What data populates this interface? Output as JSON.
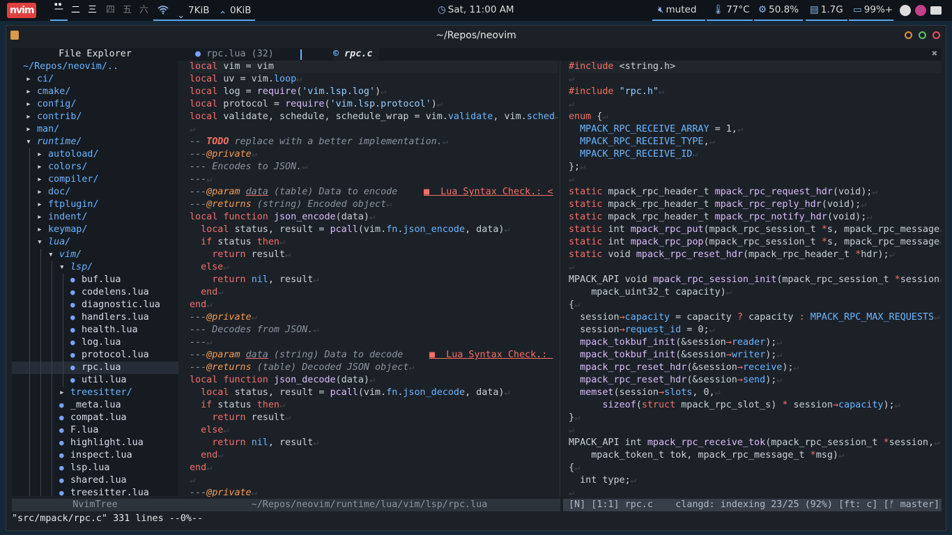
{
  "topbar": {
    "logo": "nvim",
    "workspaces": [
      "一",
      "二",
      "三",
      "四",
      "五",
      "六"
    ],
    "net_down": "7KiB",
    "net_up": "0KiB",
    "clock": "Sat, 11:00 AM",
    "volume": "muted",
    "temp": "77°C",
    "cpu": "50.8%",
    "mem": "1.7G",
    "battery": "99%+",
    "colors": {
      "accent": "#5fa8e8",
      "logo": "#e04040"
    }
  },
  "window": {
    "title": "~/Repos/neovim"
  },
  "tree": {
    "header": "File Explorer",
    "root": "~/Repos/neovim/..",
    "rows": [
      {
        "name": "ci/",
        "kind": "folder",
        "depth": 0,
        "open": false
      },
      {
        "name": "cmake/",
        "kind": "folder",
        "depth": 0,
        "open": false
      },
      {
        "name": "config/",
        "kind": "folder",
        "depth": 0,
        "open": false
      },
      {
        "name": "contrib/",
        "kind": "folder",
        "depth": 0,
        "open": false
      },
      {
        "name": "man/",
        "kind": "folder",
        "depth": 0,
        "open": false
      },
      {
        "name": "runtime/",
        "kind": "folder",
        "depth": 0,
        "open": true
      },
      {
        "name": "autoload/",
        "kind": "folder",
        "depth": 1,
        "open": false
      },
      {
        "name": "colors/",
        "kind": "folder",
        "depth": 1,
        "open": false
      },
      {
        "name": "compiler/",
        "kind": "folder",
        "depth": 1,
        "open": false
      },
      {
        "name": "doc/",
        "kind": "folder",
        "depth": 1,
        "open": false
      },
      {
        "name": "ftplugin/",
        "kind": "folder",
        "depth": 1,
        "open": false
      },
      {
        "name": "indent/",
        "kind": "folder",
        "depth": 1,
        "open": false
      },
      {
        "name": "keymap/",
        "kind": "folder",
        "depth": 1,
        "open": false
      },
      {
        "name": "lua/",
        "kind": "folder",
        "depth": 1,
        "open": true
      },
      {
        "name": "vim/",
        "kind": "folder",
        "depth": 2,
        "open": true
      },
      {
        "name": "lsp/",
        "kind": "folder",
        "depth": 3,
        "open": true
      },
      {
        "name": "buf.lua",
        "kind": "file",
        "depth": 4
      },
      {
        "name": "codelens.lua",
        "kind": "file",
        "depth": 4
      },
      {
        "name": "diagnostic.lua",
        "kind": "file",
        "depth": 4
      },
      {
        "name": "handlers.lua",
        "kind": "file",
        "depth": 4
      },
      {
        "name": "health.lua",
        "kind": "file",
        "depth": 4
      },
      {
        "name": "log.lua",
        "kind": "file",
        "depth": 4
      },
      {
        "name": "protocol.lua",
        "kind": "file",
        "depth": 4
      },
      {
        "name": "rpc.lua",
        "kind": "file",
        "depth": 4,
        "selected": true
      },
      {
        "name": "util.lua",
        "kind": "file",
        "depth": 4
      },
      {
        "name": "treesitter/",
        "kind": "folder",
        "depth": 3,
        "open": false
      },
      {
        "name": "_meta.lua",
        "kind": "file",
        "depth": 3
      },
      {
        "name": "compat.lua",
        "kind": "file",
        "depth": 3
      },
      {
        "name": "F.lua",
        "kind": "file",
        "depth": 3
      },
      {
        "name": "highlight.lua",
        "kind": "file",
        "depth": 3
      },
      {
        "name": "inspect.lua",
        "kind": "file",
        "depth": 3
      },
      {
        "name": "lsp.lua",
        "kind": "file",
        "depth": 3
      },
      {
        "name": "shared.lua",
        "kind": "file",
        "depth": 3
      },
      {
        "name": "treesitter.lua",
        "kind": "file",
        "depth": 3
      }
    ]
  },
  "tabs": {
    "inactive_name": "rpc.lua",
    "inactive_count": "(32)",
    "active_name": "rpc.c",
    "close": "✖"
  },
  "lua_lines": [
    [
      [
        "kw",
        "local"
      ],
      [
        "t",
        " vim = vim"
      ]
    ],
    [
      [
        "kw",
        "local"
      ],
      [
        "t",
        " uv = vim."
      ],
      [
        "prop",
        "loop"
      ]
    ],
    [
      [
        "kw",
        "local"
      ],
      [
        "t",
        " log = "
      ],
      [
        "fn",
        "require"
      ],
      [
        "t",
        "("
      ],
      [
        "str",
        "'vim.lsp.log'"
      ],
      [
        "t",
        ")"
      ]
    ],
    [
      [
        "kw",
        "local"
      ],
      [
        "t",
        " protocol = "
      ],
      [
        "fn",
        "require"
      ],
      [
        "t",
        "("
      ],
      [
        "str",
        "'vim.lsp.protocol'"
      ],
      [
        "t",
        ")"
      ]
    ],
    [
      [
        "kw",
        "local"
      ],
      [
        "t",
        " validate, schedule, schedule_wrap = vim."
      ],
      [
        "prop",
        "validate"
      ],
      [
        "t",
        ", vim."
      ],
      [
        "prop",
        "sched"
      ]
    ],
    [],
    [
      [
        "cm",
        "-- "
      ],
      [
        "todo",
        "TODO"
      ],
      [
        "cm",
        " replace with a better implementation."
      ]
    ],
    [
      [
        "cm",
        "---"
      ],
      [
        "ann",
        "@private"
      ]
    ],
    [
      [
        "cm",
        "--- Encodes to JSON."
      ]
    ],
    [
      [
        "cm",
        "---"
      ]
    ],
    [
      [
        "cm",
        "---"
      ],
      [
        "ann",
        "@param"
      ],
      [
        "cm",
        " "
      ],
      [
        "cmu",
        "data"
      ],
      [
        "cm",
        " (table) Data to encode"
      ],
      [
        "diag",
        "■  Lua Syntax Check.: <"
      ]
    ],
    [
      [
        "cm",
        "---"
      ],
      [
        "ann",
        "@returns"
      ],
      [
        "cm",
        " (string) Encoded object"
      ]
    ],
    [
      [
        "kw",
        "local function"
      ],
      [
        "t",
        " "
      ],
      [
        "fn",
        "json_encode"
      ],
      [
        "t",
        "(data)"
      ]
    ],
    [
      [
        "t",
        "  "
      ],
      [
        "kw",
        "local"
      ],
      [
        "t",
        " status, result = "
      ],
      [
        "fn",
        "pcall"
      ],
      [
        "t",
        "(vim."
      ],
      [
        "prop",
        "fn"
      ],
      [
        "t",
        "."
      ],
      [
        "prop",
        "json_encode"
      ],
      [
        "t",
        ", data)"
      ]
    ],
    [
      [
        "t",
        "  "
      ],
      [
        "kw",
        "if"
      ],
      [
        "t",
        " status "
      ],
      [
        "kw",
        "then"
      ]
    ],
    [
      [
        "t",
        "    "
      ],
      [
        "kw",
        "return"
      ],
      [
        "t",
        " result"
      ]
    ],
    [
      [
        "t",
        "  "
      ],
      [
        "kw",
        "else"
      ]
    ],
    [
      [
        "t",
        "    "
      ],
      [
        "kw",
        "return"
      ],
      [
        "t",
        " "
      ],
      [
        "prop",
        "nil"
      ],
      [
        "t",
        ", result"
      ]
    ],
    [
      [
        "t",
        "  "
      ],
      [
        "kw",
        "end"
      ]
    ],
    [
      [
        "kw",
        "end"
      ]
    ],
    [
      [
        "cm",
        "---"
      ],
      [
        "ann",
        "@private"
      ]
    ],
    [
      [
        "cm",
        "--- Decodes from JSON."
      ]
    ],
    [
      [
        "cm",
        "---"
      ]
    ],
    [
      [
        "cm",
        "---"
      ],
      [
        "ann",
        "@param"
      ],
      [
        "cm",
        " "
      ],
      [
        "cmu",
        "data"
      ],
      [
        "cm",
        " (string) Data to decode"
      ],
      [
        "diag",
        "■  Lua Syntax Check.: "
      ]
    ],
    [
      [
        "cm",
        "---"
      ],
      [
        "ann",
        "@returns"
      ],
      [
        "cm",
        " (table) Decoded JSON object"
      ]
    ],
    [
      [
        "kw",
        "local function"
      ],
      [
        "t",
        " "
      ],
      [
        "fn",
        "json_decode"
      ],
      [
        "t",
        "(data)"
      ]
    ],
    [
      [
        "t",
        "  "
      ],
      [
        "kw",
        "local"
      ],
      [
        "t",
        " status, result = "
      ],
      [
        "fn",
        "pcall"
      ],
      [
        "t",
        "(vim."
      ],
      [
        "prop",
        "fn"
      ],
      [
        "t",
        "."
      ],
      [
        "prop",
        "json_decode"
      ],
      [
        "t",
        ", data)"
      ]
    ],
    [
      [
        "t",
        "  "
      ],
      [
        "kw",
        "if"
      ],
      [
        "t",
        " status "
      ],
      [
        "kw",
        "then"
      ]
    ],
    [
      [
        "t",
        "    "
      ],
      [
        "kw",
        "return"
      ],
      [
        "t",
        " result"
      ]
    ],
    [
      [
        "t",
        "  "
      ],
      [
        "kw",
        "else"
      ]
    ],
    [
      [
        "t",
        "    "
      ],
      [
        "kw",
        "return"
      ],
      [
        "t",
        " "
      ],
      [
        "prop",
        "nil"
      ],
      [
        "t",
        ", result"
      ]
    ],
    [
      [
        "t",
        "  "
      ],
      [
        "kw",
        "end"
      ]
    ],
    [
      [
        "kw",
        "end"
      ]
    ],
    [],
    [
      [
        "cm",
        "---"
      ],
      [
        "ann",
        "@private"
      ]
    ]
  ],
  "lua_error_lines": [
    10,
    23
  ],
  "c_lines": [
    [
      [
        "pp",
        "#include"
      ],
      [
        "t",
        " <string.h>"
      ]
    ],
    [],
    [
      [
        "pp",
        "#include"
      ],
      [
        "t",
        " "
      ],
      [
        "str",
        "\"rpc.h\""
      ]
    ],
    [],
    [
      [
        "kw",
        "enum"
      ],
      [
        "t",
        " {"
      ]
    ],
    [
      [
        "t",
        "  "
      ],
      [
        "const",
        "MPACK_RPC_RECEIVE_ARRAY"
      ],
      [
        "t",
        " = 1,"
      ]
    ],
    [
      [
        "t",
        "  "
      ],
      [
        "const",
        "MPACK_RPC_RECEIVE_TYPE"
      ],
      [
        "t",
        ","
      ]
    ],
    [
      [
        "t",
        "  "
      ],
      [
        "const",
        "MPACK_RPC_RECEIVE_ID"
      ]
    ],
    [
      [
        "t",
        "};"
      ]
    ],
    [],
    [
      [
        "kw",
        "static"
      ],
      [
        "t",
        " mpack_rpc_header_t "
      ],
      [
        "fn",
        "mpack_rpc_request_hdr"
      ],
      [
        "t",
        "(void);"
      ]
    ],
    [
      [
        "kw",
        "static"
      ],
      [
        "t",
        " mpack_rpc_header_t "
      ],
      [
        "fn",
        "mpack_rpc_reply_hdr"
      ],
      [
        "t",
        "(void);"
      ]
    ],
    [
      [
        "kw",
        "static"
      ],
      [
        "t",
        " mpack_rpc_header_t "
      ],
      [
        "fn",
        "mpack_rpc_notify_hdr"
      ],
      [
        "t",
        "(void);"
      ]
    ],
    [
      [
        "kw",
        "static"
      ],
      [
        "t",
        " int "
      ],
      [
        "fn",
        "mpack_rpc_put"
      ],
      [
        "t",
        "(mpack_rpc_session_t "
      ],
      [
        "ptr",
        "*"
      ],
      [
        "t",
        "s, mpack_rpc_message"
      ]
    ],
    [
      [
        "kw",
        "static"
      ],
      [
        "t",
        " int "
      ],
      [
        "fn",
        "mpack_rpc_pop"
      ],
      [
        "t",
        "(mpack_rpc_session_t "
      ],
      [
        "ptr",
        "*"
      ],
      [
        "t",
        "s, mpack_rpc_message"
      ]
    ],
    [
      [
        "kw",
        "static"
      ],
      [
        "t",
        " void "
      ],
      [
        "fn",
        "mpack_rpc_reset_hdr"
      ],
      [
        "t",
        "(mpack_rpc_header_t "
      ],
      [
        "ptr",
        "*"
      ],
      [
        "t",
        "hdr);"
      ]
    ],
    [],
    [
      [
        "t",
        "MPACK_API void "
      ],
      [
        "fn",
        "mpack_rpc_session_init"
      ],
      [
        "t",
        "(mpack_rpc_session_t "
      ],
      [
        "ptr",
        "*"
      ],
      [
        "t",
        "session"
      ]
    ],
    [
      [
        "t",
        "    mpack_uint32_t capacity)"
      ]
    ],
    [
      [
        "t",
        "{"
      ]
    ],
    [
      [
        "t",
        "  session"
      ],
      [
        "kw",
        "→"
      ],
      [
        "prop",
        "capacity"
      ],
      [
        "t",
        " = capacity "
      ],
      [
        "kw",
        "?"
      ],
      [
        "t",
        " capacity "
      ],
      [
        "kw",
        ":"
      ],
      [
        "t",
        " "
      ],
      [
        "const",
        "MPACK_RPC_MAX_REQUESTS"
      ]
    ],
    [
      [
        "t",
        "  session"
      ],
      [
        "kw",
        "→"
      ],
      [
        "prop",
        "request_id"
      ],
      [
        "t",
        " = 0;"
      ]
    ],
    [
      [
        "t",
        "  "
      ],
      [
        "fn",
        "mpack_tokbuf_init"
      ],
      [
        "t",
        "(&session"
      ],
      [
        "kw",
        "→"
      ],
      [
        "prop",
        "reader"
      ],
      [
        "t",
        ");"
      ]
    ],
    [
      [
        "t",
        "  "
      ],
      [
        "fn",
        "mpack_tokbuf_init"
      ],
      [
        "t",
        "(&session"
      ],
      [
        "kw",
        "→"
      ],
      [
        "prop",
        "writer"
      ],
      [
        "t",
        ");"
      ]
    ],
    [
      [
        "t",
        "  "
      ],
      [
        "fn",
        "mpack_rpc_reset_hdr"
      ],
      [
        "t",
        "(&session"
      ],
      [
        "kw",
        "→"
      ],
      [
        "prop",
        "receive"
      ],
      [
        "t",
        ");"
      ]
    ],
    [
      [
        "t",
        "  "
      ],
      [
        "fn",
        "mpack_rpc_reset_hdr"
      ],
      [
        "t",
        "(&session"
      ],
      [
        "kw",
        "→"
      ],
      [
        "prop",
        "send"
      ],
      [
        "t",
        ");"
      ]
    ],
    [
      [
        "t",
        "  "
      ],
      [
        "fn",
        "memset"
      ],
      [
        "t",
        "(session"
      ],
      [
        "kw",
        "→"
      ],
      [
        "prop",
        "slots"
      ],
      [
        "t",
        ", 0,"
      ]
    ],
    [
      [
        "t",
        "      "
      ],
      [
        "fn",
        "sizeof"
      ],
      [
        "t",
        "("
      ],
      [
        "kw",
        "struct"
      ],
      [
        "t",
        " mpack_rpc_slot_s) "
      ],
      [
        "kw",
        "*"
      ],
      [
        "t",
        " session"
      ],
      [
        "kw",
        "→"
      ],
      [
        "prop",
        "capacity"
      ],
      [
        "t",
        ");"
      ]
    ],
    [
      [
        "t",
        "}"
      ]
    ],
    [],
    [
      [
        "t",
        "MPACK_API int "
      ],
      [
        "fn",
        "mpack_rpc_receive_tok"
      ],
      [
        "t",
        "(mpack_rpc_session_t "
      ],
      [
        "ptr",
        "*"
      ],
      [
        "t",
        "session,"
      ]
    ],
    [
      [
        "t",
        "    mpack_token_t tok, mpack_rpc_message_t "
      ],
      [
        "ptr",
        "*"
      ],
      [
        "t",
        "msg)"
      ]
    ],
    [
      [
        "t",
        "{"
      ]
    ],
    [
      [
        "t",
        "  int type;"
      ]
    ],
    []
  ],
  "status": {
    "tree_label": "NvimTree",
    "lua_path": "~/Repos/neovim/runtime/lua/vim/lsp/rpc.lua",
    "c_status": "[N] [1:1] rpc.c    clangd: indexing 23/25 (92%) [ft: c] [ᚠ master]"
  },
  "cmdline": "\"src/mpack/rpc.c\" 331 lines --0%--"
}
